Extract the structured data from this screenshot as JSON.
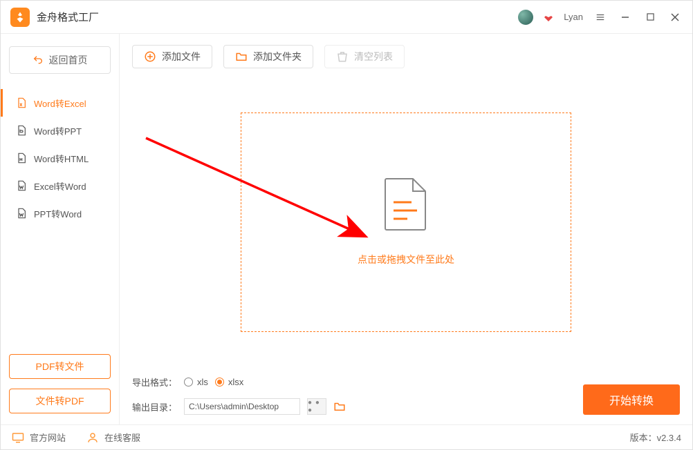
{
  "app": {
    "title": "金舟格式工厂",
    "username": "Lyan",
    "version_label": "版本：",
    "version": "v2.3.4"
  },
  "sidebar": {
    "back_label": "返回首页",
    "items": [
      {
        "label": "Word转Excel"
      },
      {
        "label": "Word转PPT"
      },
      {
        "label": "Word转HTML"
      },
      {
        "label": "Excel转Word"
      },
      {
        "label": "PPT转Word"
      }
    ],
    "pdf_to_file": "PDF转文件",
    "file_to_pdf": "文件转PDF"
  },
  "toolbar": {
    "add_file": "添加文件",
    "add_folder": "添加文件夹",
    "clear_list": "清空列表"
  },
  "dropzone": {
    "hint": "点击或拖拽文件至此处"
  },
  "export": {
    "format_label": "导出格式：",
    "opt_xls": "xls",
    "opt_xlsx": "xlsx",
    "output_label": "输出目录：",
    "output_path": "C:\\Users\\admin\\Desktop"
  },
  "convert": {
    "label": "开始转换"
  },
  "footer": {
    "official_site": "官方网站",
    "online_support": "在线客服"
  }
}
